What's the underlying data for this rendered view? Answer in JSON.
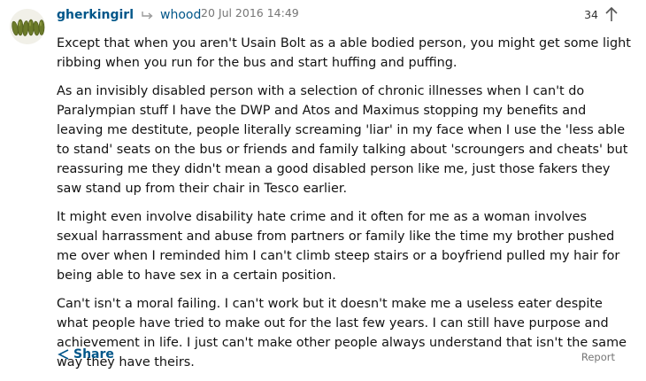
{
  "comment": {
    "author": "gherkingirl",
    "reply_icon": "reply-arrow-icon",
    "reply_to": "whood",
    "timestamp": "20 Jul 2016 14:49",
    "recommend_count": "34",
    "recommend_icon": "arrow-up-icon",
    "paragraphs": [
      "Except that when you aren't Usain Bolt as a able bodied person, you might get some light ribbing when you run for the bus and start huffing and puffing.",
      "As an invisibly disabled person with a selection of chronic illnesses when I can't do Paralympian stuff I have the DWP and Atos and Maximus stopping my benefits and leaving me destitute, people literally screaming 'liar' in my face when I use the 'less able to stand' seats on the bus or friends and family talking about 'scroungers and cheats' but reassuring me they didn't mean a good disabled person like me, just those fakers they saw stand up from their chair in Tesco earlier.",
      "It might even involve disability hate crime and it often for me as a woman involves sexual harrassment and abuse from partners or family like the time my brother pushed me over when I reminded him I can't climb steep stairs or a boyfriend pulled my hair for being able to have sex in a certain position.",
      "Can't isn't a moral failing. I can't work but it doesn't make me a useless eater despite what people have tried to make out for the last few years. I can still have purpose and achievement in life. I just can't make other people always understand that isn't the same way they have theirs."
    ],
    "share_label": "Share",
    "share_icon": "share-icon",
    "report_label": "Report",
    "avatar_icon": "gherkins-avatar"
  },
  "colors": {
    "link": "#005689",
    "meta": "#767676",
    "text": "#121212"
  }
}
